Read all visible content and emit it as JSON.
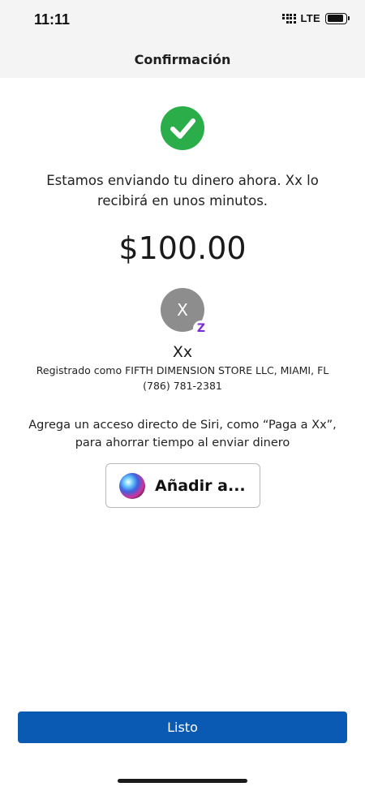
{
  "status_bar": {
    "time": "11:11",
    "network": "LTE",
    "icons": [
      "signal-icon",
      "battery-icon"
    ]
  },
  "header": {
    "title": "Confirmación"
  },
  "confirmation": {
    "icon": "check-circle-icon",
    "icon_color": "#2bae4a",
    "message": "Estamos enviando tu dinero ahora. Xx lo recibirá en unos minutos.",
    "amount": "$100.00"
  },
  "recipient": {
    "initial": "X",
    "badge_icon": "zelle-icon",
    "badge_glyph": "Z",
    "name": "Xx",
    "registered": "Registrado como FIFTH DIMENSION STORE LLC, MIAMI, FL",
    "phone": "(786) 781-2381"
  },
  "siri": {
    "prompt": "Agrega un acceso directo de Siri, como “Paga a Xx”, para ahorrar tiempo al enviar dinero",
    "icon": "siri-icon",
    "button_label": "Añadir a..."
  },
  "footer": {
    "done_label": "Listo",
    "accent_color": "#0a5ab4"
  }
}
